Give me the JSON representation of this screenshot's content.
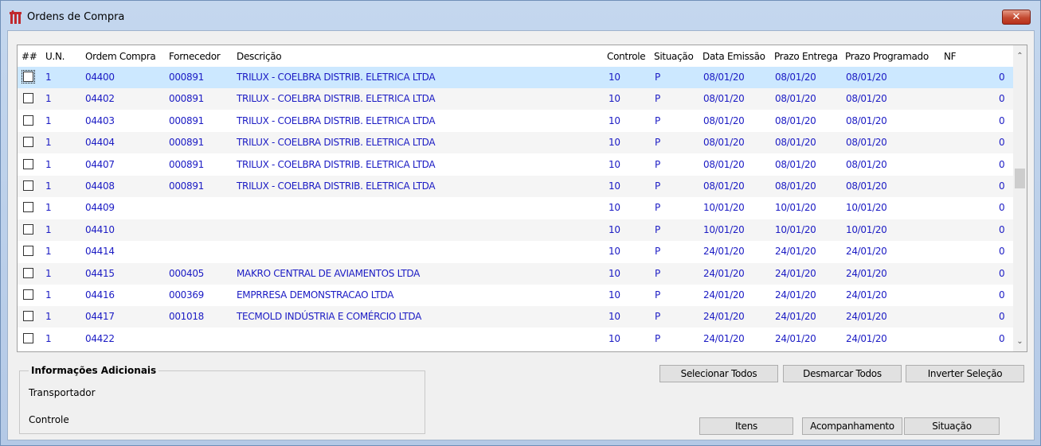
{
  "window": {
    "title": "Ordens de Compra",
    "close_label": "✕"
  },
  "grid": {
    "columns": [
      "##",
      "U.N.",
      "Ordem Compra",
      "Fornecedor",
      "Descrição",
      "Controle",
      "Situação",
      "Data Emissão",
      "Prazo Entrega",
      "Prazo Programado",
      "NF"
    ],
    "rows": [
      {
        "un": "1",
        "ordem": "04400",
        "fornecedor": "000891",
        "descricao": "TRILUX - COELBRA DISTRIB. ELETRICA LTDA",
        "controle": "10",
        "situacao": "P",
        "emissao": "08/01/20",
        "entrega": "08/01/20",
        "programado": "08/01/20",
        "nf": "0"
      },
      {
        "un": "1",
        "ordem": "04402",
        "fornecedor": "000891",
        "descricao": "TRILUX - COELBRA DISTRIB. ELETRICA LTDA",
        "controle": "10",
        "situacao": "P",
        "emissao": "08/01/20",
        "entrega": "08/01/20",
        "programado": "08/01/20",
        "nf": "0"
      },
      {
        "un": "1",
        "ordem": "04403",
        "fornecedor": "000891",
        "descricao": "TRILUX - COELBRA DISTRIB. ELETRICA LTDA",
        "controle": "10",
        "situacao": "P",
        "emissao": "08/01/20",
        "entrega": "08/01/20",
        "programado": "08/01/20",
        "nf": "0"
      },
      {
        "un": "1",
        "ordem": "04404",
        "fornecedor": "000891",
        "descricao": "TRILUX - COELBRA DISTRIB. ELETRICA LTDA",
        "controle": "10",
        "situacao": "P",
        "emissao": "08/01/20",
        "entrega": "08/01/20",
        "programado": "08/01/20",
        "nf": "0"
      },
      {
        "un": "1",
        "ordem": "04407",
        "fornecedor": "000891",
        "descricao": "TRILUX - COELBRA DISTRIB. ELETRICA LTDA",
        "controle": "10",
        "situacao": "P",
        "emissao": "08/01/20",
        "entrega": "08/01/20",
        "programado": "08/01/20",
        "nf": "0"
      },
      {
        "un": "1",
        "ordem": "04408",
        "fornecedor": "000891",
        "descricao": "TRILUX - COELBRA DISTRIB. ELETRICA LTDA",
        "controle": "10",
        "situacao": "P",
        "emissao": "08/01/20",
        "entrega": "08/01/20",
        "programado": "08/01/20",
        "nf": "0"
      },
      {
        "un": "1",
        "ordem": "04409",
        "fornecedor": "",
        "descricao": "",
        "controle": "10",
        "situacao": "P",
        "emissao": "10/01/20",
        "entrega": "10/01/20",
        "programado": "10/01/20",
        "nf": "0"
      },
      {
        "un": "1",
        "ordem": "04410",
        "fornecedor": "",
        "descricao": "",
        "controle": "10",
        "situacao": "P",
        "emissao": "10/01/20",
        "entrega": "10/01/20",
        "programado": "10/01/20",
        "nf": "0"
      },
      {
        "un": "1",
        "ordem": "04414",
        "fornecedor": "",
        "descricao": "",
        "controle": "10",
        "situacao": "P",
        "emissao": "24/01/20",
        "entrega": "24/01/20",
        "programado": "24/01/20",
        "nf": "0"
      },
      {
        "un": "1",
        "ordem": "04415",
        "fornecedor": "000405",
        "descricao": "MAKRO CENTRAL DE AVIAMENTOS LTDA",
        "controle": "10",
        "situacao": "P",
        "emissao": "24/01/20",
        "entrega": "24/01/20",
        "programado": "24/01/20",
        "nf": "0"
      },
      {
        "un": "1",
        "ordem": "04416",
        "fornecedor": "000369",
        "descricao": "EMPRRESA DEMONSTRACAO LTDA",
        "controle": "10",
        "situacao": "P",
        "emissao": "24/01/20",
        "entrega": "24/01/20",
        "programado": "24/01/20",
        "nf": "0"
      },
      {
        "un": "1",
        "ordem": "04417",
        "fornecedor": "001018",
        "descricao": "TECMOLD INDÚSTRIA E COMÉRCIO LTDA",
        "controle": "10",
        "situacao": "P",
        "emissao": "24/01/20",
        "entrega": "24/01/20",
        "programado": "24/01/20",
        "nf": "0"
      },
      {
        "un": "1",
        "ordem": "04422",
        "fornecedor": "",
        "descricao": "",
        "controle": "10",
        "situacao": "P",
        "emissao": "24/01/20",
        "entrega": "24/01/20",
        "programado": "24/01/20",
        "nf": "0"
      }
    ],
    "selected_row": 0
  },
  "info": {
    "legend": "Informações Adicionais",
    "transportador_label": "Transportador",
    "controle_label": "Controle"
  },
  "buttons": {
    "selecionar_todos": "Selecionar Todos",
    "desmarcar_todos": "Desmarcar Todos",
    "inverter_selecao": "Inverter Seleção",
    "itens": "Itens",
    "acompanhamento": "Acompanhamento",
    "situacao": "Situação"
  },
  "colors": {
    "text_blue": "#1b1bc4",
    "selected_row": "#cce8ff",
    "close_red": "#c44a31"
  }
}
